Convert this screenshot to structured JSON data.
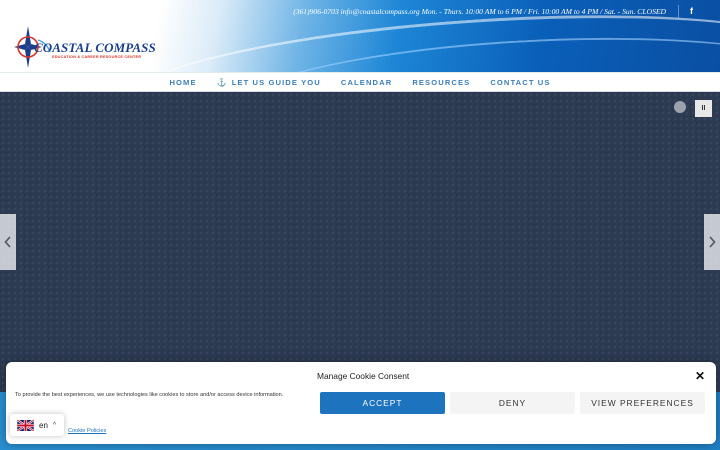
{
  "header": {
    "contact_line": "(361)906-0703 info@coastalcompass.org Mon. - Thurs. 10:00 AM to 6 PM / Fri. 10:00 AM to 4 PM / Sat. - Sun. CLOSED",
    "social_icon": "facebook-icon",
    "social_glyph": "f"
  },
  "logo": {
    "title": "COASTAL COMPASS",
    "subtitle": "EDUCATION & CAREER RESOURCE CENTER"
  },
  "nav": {
    "items": [
      {
        "label": "HOME"
      },
      {
        "label": "LET US GUIDE YOU",
        "icon": "anchor-icon",
        "glyph": "⚓"
      },
      {
        "label": "CALENDAR"
      },
      {
        "label": "RESOURCES"
      },
      {
        "label": "CONTACT US"
      }
    ]
  },
  "slider": {
    "pause_glyph": "II",
    "prev_icon": "chevron-left-icon",
    "next_icon": "chevron-right-icon"
  },
  "cookie": {
    "title": "Manage Cookie Consent",
    "close_glyph": "✕",
    "text": "To provide the best experiences, we use technologies like cookies to store and/or access device information.",
    "accept_label": "ACCEPT",
    "deny_label": "DENY",
    "preferences_label": "VIEW PREFERENCES",
    "policy_link": "Cookie Policies"
  },
  "language": {
    "label": "en",
    "caret": "^",
    "flag_icon": "uk-flag-icon"
  },
  "colors": {
    "accent": "#1e73be",
    "nav_text": "#3d7fb8",
    "logo_blue": "#1b3f8c",
    "logo_red": "#d8322a"
  }
}
